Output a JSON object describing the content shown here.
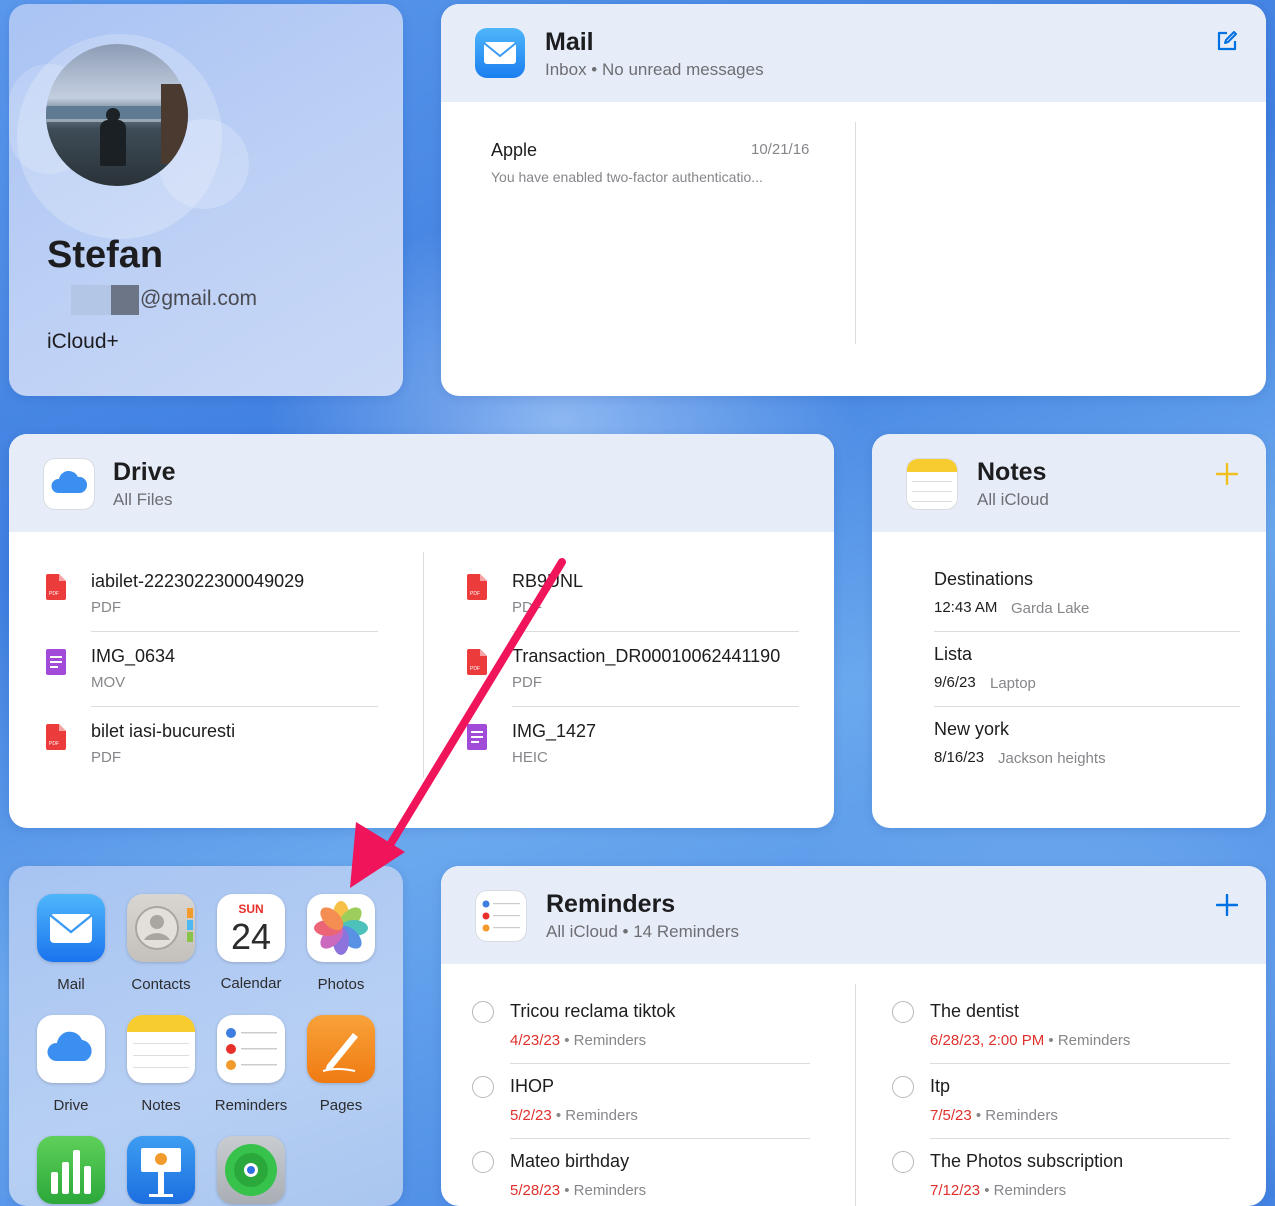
{
  "profile": {
    "name": "Stefan",
    "email": "@gmail.com",
    "plan": "iCloud+"
  },
  "mail": {
    "title": "Mail",
    "subtitle": "Inbox • No unread messages",
    "messages": [
      {
        "sender": "Apple",
        "date": "10/21/16",
        "preview": "You have enabled two-factor authenticatio..."
      }
    ]
  },
  "drive": {
    "title": "Drive",
    "subtitle": "All Files",
    "files": [
      {
        "name": "iabilet-2223022300049029",
        "type": "PDF",
        "icon": "pdf-icon"
      },
      {
        "name": "IMG_0634",
        "type": "MOV",
        "icon": "document-icon"
      },
      {
        "name": "bilet iasi-bucuresti",
        "type": "PDF",
        "icon": "pdf-icon"
      },
      {
        "name": "RB9UNL",
        "type": "PDF",
        "icon": "pdf-icon"
      },
      {
        "name": "Transaction_DR00010062441190",
        "type": "PDF",
        "icon": "pdf-icon"
      },
      {
        "name": "IMG_1427",
        "type": "HEIC",
        "icon": "document-icon"
      }
    ]
  },
  "notes": {
    "title": "Notes",
    "subtitle": "All iCloud",
    "items": [
      {
        "title": "Destinations",
        "date": "12:43 AM",
        "preview": "Garda Lake"
      },
      {
        "title": "Lista",
        "date": "9/6/23",
        "preview": "Laptop"
      },
      {
        "title": "New york",
        "date": "8/16/23",
        "preview": "Jackson heights"
      }
    ]
  },
  "reminders": {
    "title": "Reminders",
    "subtitle": "All iCloud • 14 Reminders",
    "items": [
      {
        "title": "Tricou reclama tiktok",
        "due": "4/23/23",
        "list": "• Reminders"
      },
      {
        "title": "IHOP",
        "due": "5/2/23",
        "list": "• Reminders"
      },
      {
        "title": "Mateo birthday",
        "due": "5/28/23",
        "list": "• Reminders"
      },
      {
        "title": "The dentist",
        "due": "6/28/23, 2:00 PM",
        "list": "• Reminders"
      },
      {
        "title": "Itp",
        "due": "7/5/23",
        "list": "• Reminders"
      },
      {
        "title": "The Photos subscription",
        "due": "7/12/23",
        "list": "• Reminders"
      }
    ]
  },
  "apps": [
    {
      "label": "Mail"
    },
    {
      "label": "Contacts"
    },
    {
      "label": "Calendar"
    },
    {
      "label": "Photos"
    },
    {
      "label": "Drive"
    },
    {
      "label": "Notes"
    },
    {
      "label": "Reminders"
    },
    {
      "label": "Pages"
    },
    {
      "label": ""
    },
    {
      "label": ""
    },
    {
      "label": ""
    }
  ],
  "calendar_icon": {
    "day": "SUN",
    "date": "24"
  },
  "colors": {
    "accent": "#0071e3",
    "reminder_due": "#e0302c",
    "notes_accent": "#f5c518",
    "annotation_arrow": "#f0145a"
  }
}
